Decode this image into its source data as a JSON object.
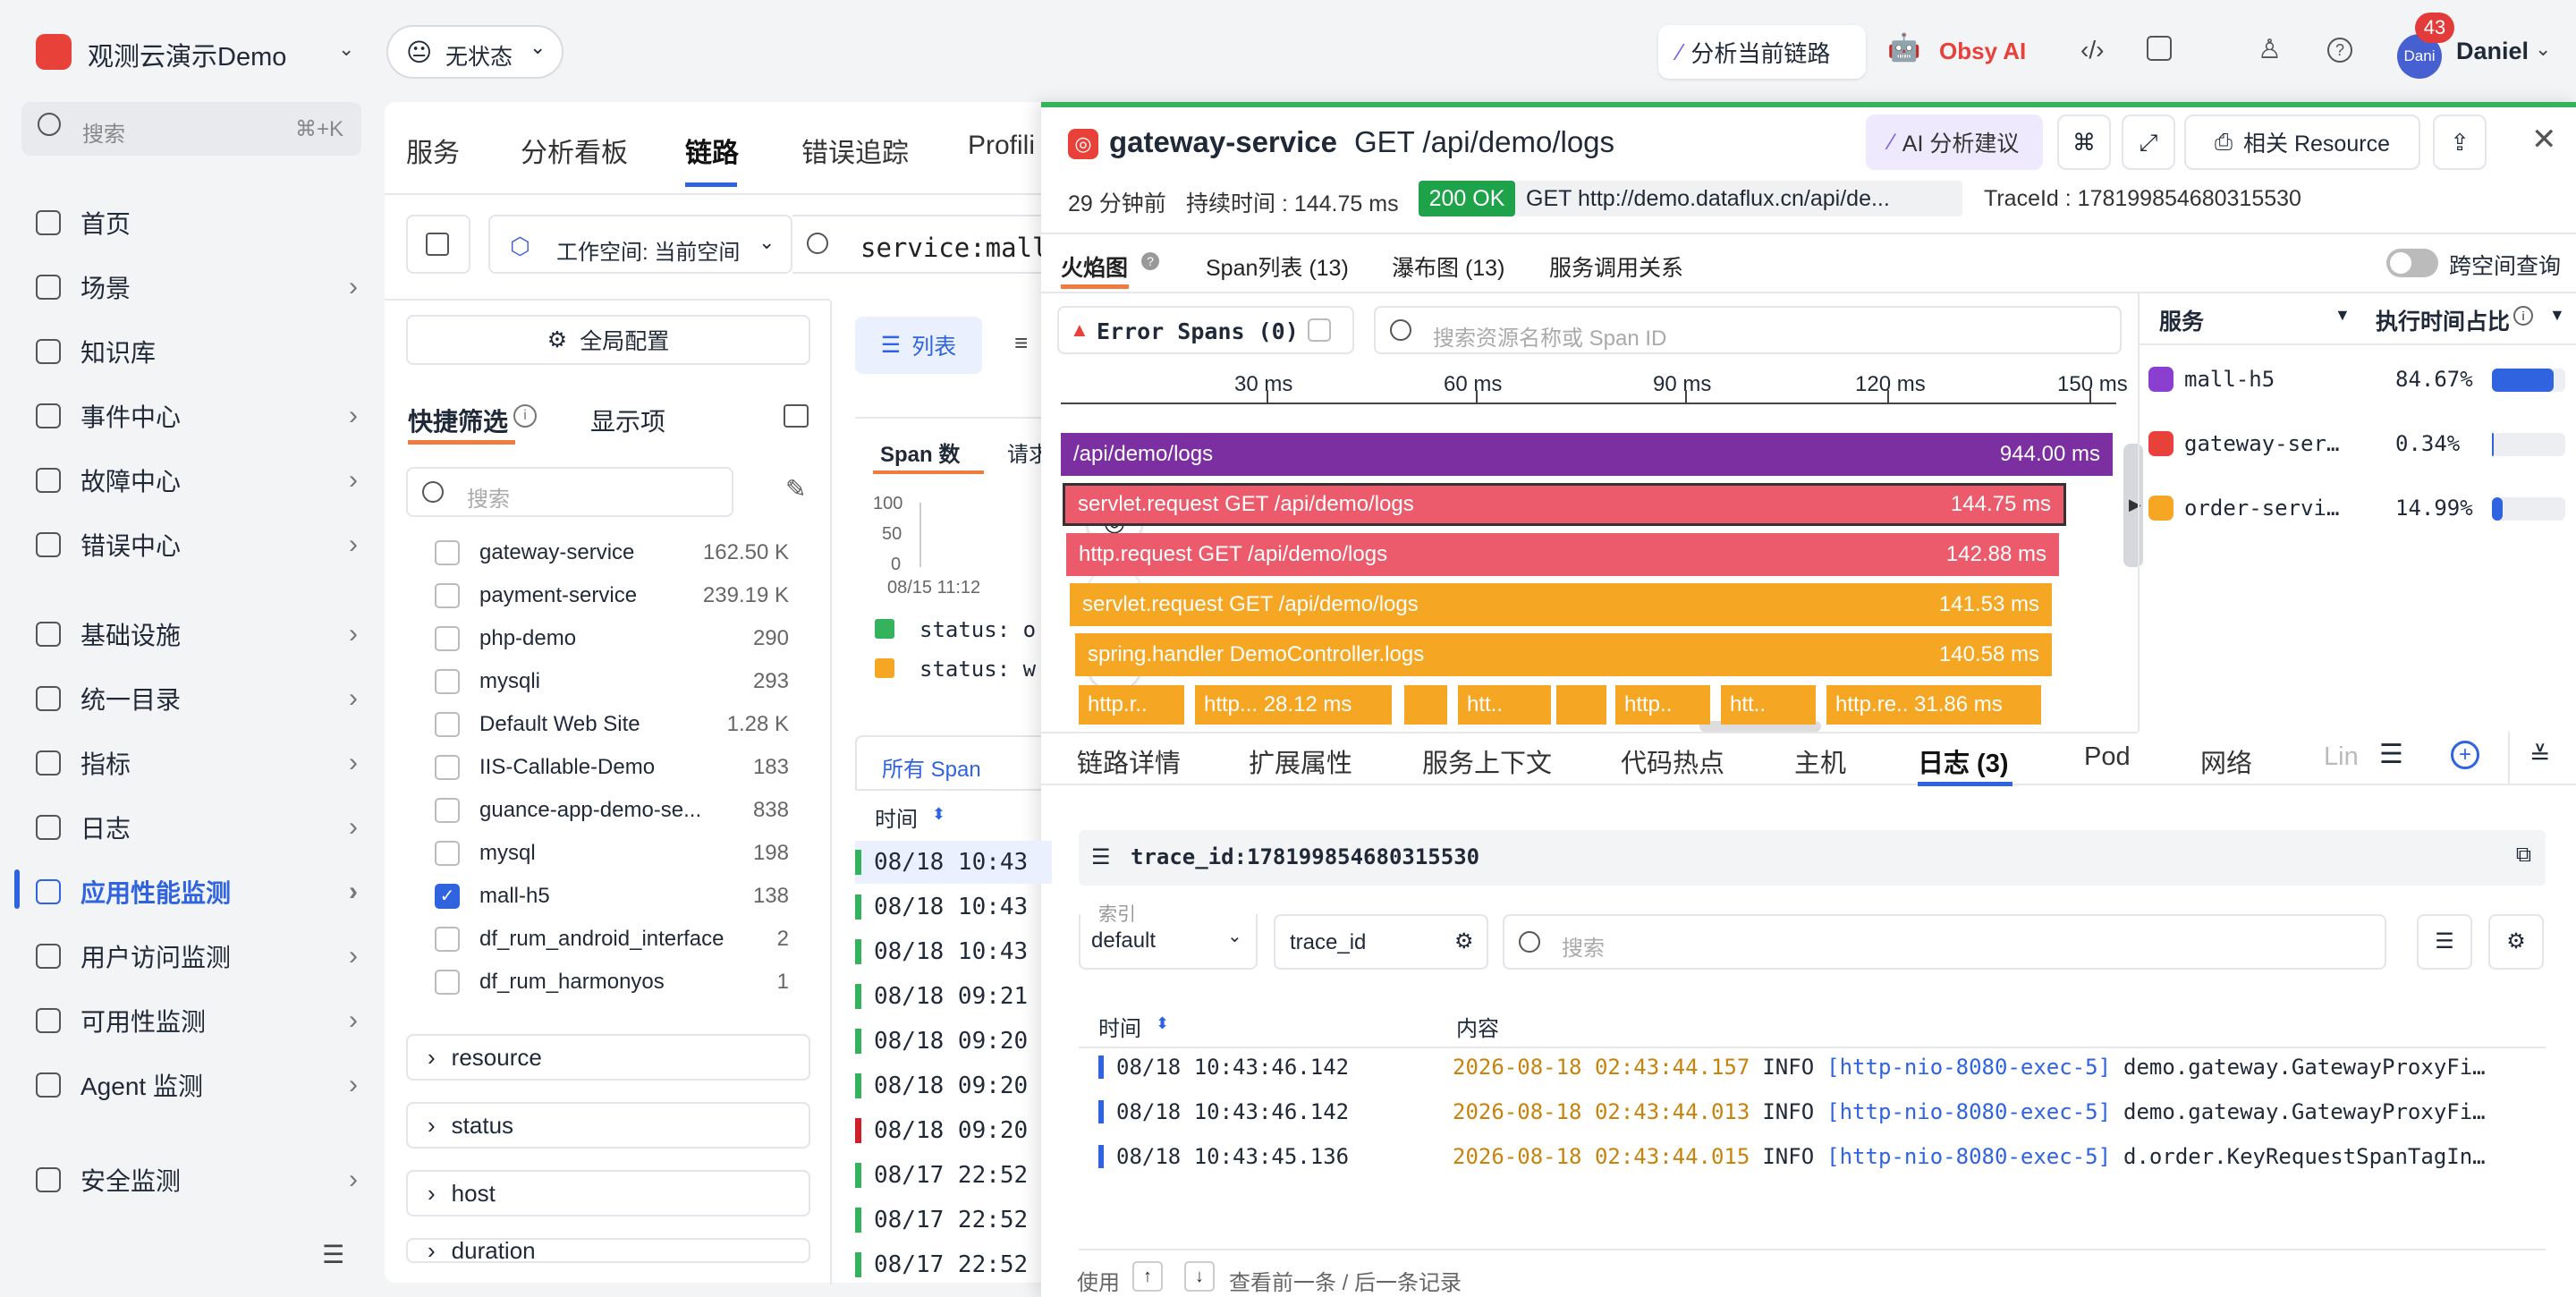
{
  "topbar": {
    "workspace": "观测云演示Demo",
    "status": "无状态",
    "analyze": "分析当前链路",
    "obsy": "Obsy AI",
    "notif_count": "43",
    "avatar": "Dani",
    "user": "Daniel"
  },
  "sidebar": {
    "search_placeholder": "搜索",
    "shortcut": "⌘+K",
    "items": [
      {
        "label": "首页"
      },
      {
        "label": "场景"
      },
      {
        "label": "知识库"
      },
      {
        "label": "事件中心"
      },
      {
        "label": "故障中心"
      },
      {
        "label": "错误中心"
      },
      {
        "label": "基础设施"
      },
      {
        "label": "统一目录"
      },
      {
        "label": "指标"
      },
      {
        "label": "日志"
      },
      {
        "label": "应用性能监测"
      },
      {
        "label": "用户访问监测"
      },
      {
        "label": "可用性监测"
      },
      {
        "label": "Agent 监测"
      },
      {
        "label": "安全监测"
      }
    ]
  },
  "main": {
    "tabs": [
      "服务",
      "分析看板",
      "链路",
      "错误追踪",
      "Profili"
    ],
    "workspace": "工作空间: 当前空间",
    "query": "service:mall",
    "global_config": "全局配置",
    "quick_filter": "快捷筛选",
    "display_items": "显示项",
    "filter_search": "搜索",
    "list": "列表",
    "filters": [
      {
        "name": "gateway-service",
        "count": "162.50 K"
      },
      {
        "name": "payment-service",
        "count": "239.19 K"
      },
      {
        "name": "php-demo",
        "count": "290"
      },
      {
        "name": "mysqli",
        "count": "293"
      },
      {
        "name": "Default Web Site",
        "count": "1.28 K"
      },
      {
        "name": "IIS-Callable-Demo",
        "count": "183"
      },
      {
        "name": "guance-app-demo-se...",
        "count": "838"
      },
      {
        "name": "mysql",
        "count": "198"
      },
      {
        "name": "mall-h5",
        "count": "138"
      },
      {
        "name": "df_rum_android_interface",
        "count": "2"
      },
      {
        "name": "df_rum_harmonyos",
        "count": "1"
      }
    ],
    "groups": [
      "resource",
      "status",
      "host",
      "duration"
    ],
    "span_tab": "Span 数",
    "req_tab": "请求",
    "y_ticks": [
      "100",
      "50",
      "0"
    ],
    "x_tick": "08/15 11:12",
    "status_o": "status: o",
    "status_w": "status: w",
    "all_span": "所有 Span",
    "time_col": "时间",
    "rows": [
      "08/18 10:43",
      "08/18 10:43",
      "08/18 10:43",
      "08/18 09:21",
      "08/18 09:20",
      "08/18 09:20",
      "08/18 09:20",
      "08/17 22:52",
      "08/17 22:52",
      "08/17 22:52"
    ]
  },
  "detail": {
    "service": "gateway-service",
    "endpoint": "GET /api/demo/logs",
    "ai": "AI 分析建议",
    "resource": "相关 Resource",
    "ago": "29 分钟前",
    "duration": "持续时间 : 144.75 ms",
    "code": "200 OK",
    "method": "GET",
    "url": "http://demo.dataflux.cn/api/de...",
    "traceid": "TraceId : 178199854680315530",
    "tabs": [
      "火焰图",
      "Span列表 (13)",
      "瀑布图 (13)",
      "服务调用关系"
    ],
    "cross": "跨空间查询",
    "error_spans": "Error Spans (0)",
    "span_search": "搜索资源名称或 Span ID",
    "ticks": [
      "30 ms",
      "60 ms",
      "90 ms",
      "120 ms",
      "150 ms"
    ],
    "flames": [
      {
        "name": "/api/demo/logs",
        "dur": "944.00 ms"
      },
      {
        "name": "servlet.request GET /api/demo/logs",
        "dur": "144.75 ms"
      },
      {
        "name": "http.request GET /api/demo/logs",
        "dur": "142.88 ms"
      },
      {
        "name": "servlet.request GET /api/demo/logs",
        "dur": "141.53 ms"
      },
      {
        "name": "spring.handler DemoController.logs",
        "dur": "140.58 ms"
      }
    ],
    "small": [
      "http.r..",
      "http... 28.12 ms",
      "htt..",
      "http..",
      "htt..",
      "http.re.. 31.86 ms"
    ],
    "svc_head": "服务",
    "exec_head": "执行时间占比",
    "svcs": [
      {
        "name": "mall-h5",
        "pct": "84.67%",
        "v": 84.67
      },
      {
        "name": "gateway-ser…",
        "pct": "0.34%",
        "v": 0.34
      },
      {
        "name": "order-servi…",
        "pct": "14.99%",
        "v": 14.99
      }
    ],
    "btabs": [
      "链路详情",
      "扩展属性",
      "服务上下文",
      "代码热点",
      "主机",
      "日志 (3)",
      "Pod",
      "网络",
      "Lin"
    ],
    "trace_filter_key": "trace_id:",
    "trace_filter_val": "178199854680315530",
    "index_label": "索引",
    "index_val": "default",
    "field_val": "trace_id",
    "log_search": "搜索",
    "col_time": "时间",
    "col_content": "内容",
    "logs": [
      {
        "t": "08/18 10:43:46.142",
        "ts": "2026-08-18 02:43:44.157",
        "lvl": "INFO",
        "thr": "[http-nio-8080-exec-5]",
        "msg": "demo.gateway.GatewayProxyFi…"
      },
      {
        "t": "08/18 10:43:46.142",
        "ts": "2026-08-18 02:43:44.013",
        "lvl": "INFO",
        "thr": "[http-nio-8080-exec-5]",
        "msg": "demo.gateway.GatewayProxyFi…"
      },
      {
        "t": "08/18 10:43:45.136",
        "ts": "2026-08-18 02:43:44.015",
        "lvl": "INFO",
        "thr": "[http-nio-8080-exec-5]",
        "msg": "d.order.KeyRequestSpanTagIn…"
      }
    ],
    "footer_use": "使用",
    "footer_hint": "查看前一条 / 后一条记录"
  },
  "colors": {
    "accent": "#2f63e0",
    "purple": "#7b2fa1",
    "red": "#ec5b6b",
    "orange": "#f5a623",
    "green": "#34b35c"
  }
}
